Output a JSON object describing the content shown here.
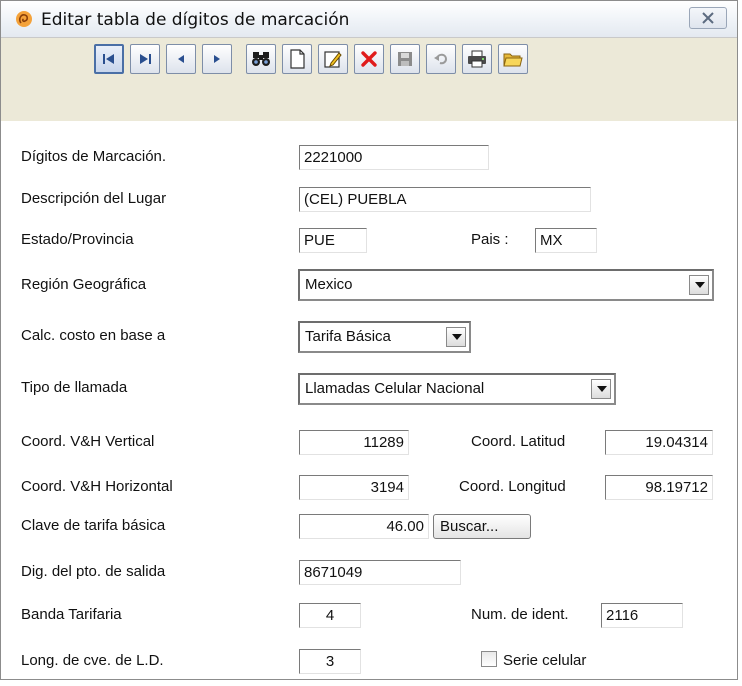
{
  "window": {
    "title": "Editar tabla de dígitos de marcación",
    "icon": "app-swirl-icon",
    "close_icon": "close-icon"
  },
  "toolbar": {
    "buttons": [
      {
        "name": "first-record-button",
        "icon": "first-record-icon"
      },
      {
        "name": "last-record-button",
        "icon": "last-record-icon"
      },
      {
        "name": "previous-record-button",
        "icon": "previous-icon"
      },
      {
        "name": "next-record-button",
        "icon": "next-icon"
      },
      {
        "name": "find-button",
        "icon": "binoculars-icon"
      },
      {
        "name": "new-record-button",
        "icon": "new-document-icon"
      },
      {
        "name": "edit-record-button",
        "icon": "edit-pencil-icon"
      },
      {
        "name": "delete-record-button",
        "icon": "delete-x-icon"
      },
      {
        "name": "save-button",
        "icon": "save-icon"
      },
      {
        "name": "undo-button",
        "icon": "undo-icon"
      },
      {
        "name": "print-button",
        "icon": "printer-icon"
      },
      {
        "name": "open-folder-button",
        "icon": "folder-icon"
      }
    ]
  },
  "form": {
    "digitos": {
      "label": "Dígitos de Marcación.",
      "value": "2221000"
    },
    "descripcion": {
      "label": "Descripción del Lugar",
      "value": "(CEL) PUEBLA"
    },
    "estado": {
      "label": "Estado/Provincia",
      "value": "PUE"
    },
    "pais": {
      "label": "Pais :",
      "value": "MX"
    },
    "region": {
      "label": "Región Geográfica",
      "value": "Mexico"
    },
    "calc_costo": {
      "label": "Calc. costo en base a",
      "value": "Tarifa Básica"
    },
    "tipo_llamada": {
      "label": "Tipo de llamada",
      "value": "Llamadas Celular Nacional"
    },
    "coord_vertical": {
      "label": "Coord. V&H Vertical",
      "value": "11289"
    },
    "coord_latitud": {
      "label": "Coord. Latitud",
      "value": "19.04314"
    },
    "coord_horizontal": {
      "label": "Coord. V&H Horizontal",
      "value": "3194"
    },
    "coord_longitud": {
      "label": "Coord. Longitud",
      "value": "98.19712"
    },
    "clave_tarifa": {
      "label": "Clave de tarifa básica",
      "value": "46.00"
    },
    "buscar": {
      "label": "Buscar..."
    },
    "dig_salida": {
      "label": "Dig. del pto. de salida",
      "value": "8671049"
    },
    "banda": {
      "label": "Banda Tarifaria",
      "value": "4"
    },
    "num_ident": {
      "label": "Num. de ident.",
      "value": "2116"
    },
    "long_cve": {
      "label": "Long. de cve. de L.D.",
      "value": "3"
    },
    "serie_celular": {
      "label": "Serie celular",
      "checked": false
    }
  }
}
